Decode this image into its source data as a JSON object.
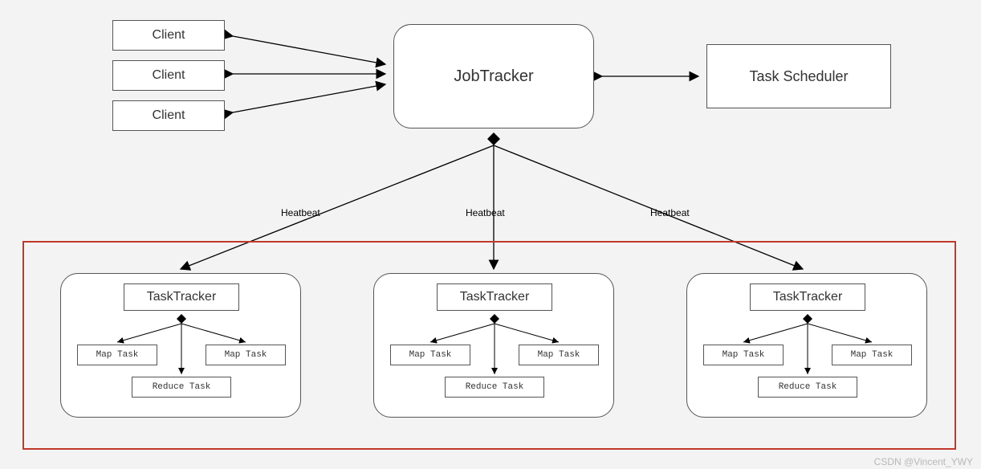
{
  "clients": [
    "Client",
    "Client",
    "Client"
  ],
  "jobtracker": "JobTracker",
  "scheduler": "Task Scheduler",
  "heartbeat_label": "Heatbeat",
  "tasktracker": {
    "label": "TaskTracker",
    "map": "Map Task",
    "reduce": "Reduce Task"
  },
  "watermark": "CSDN @Vincent_YWY"
}
